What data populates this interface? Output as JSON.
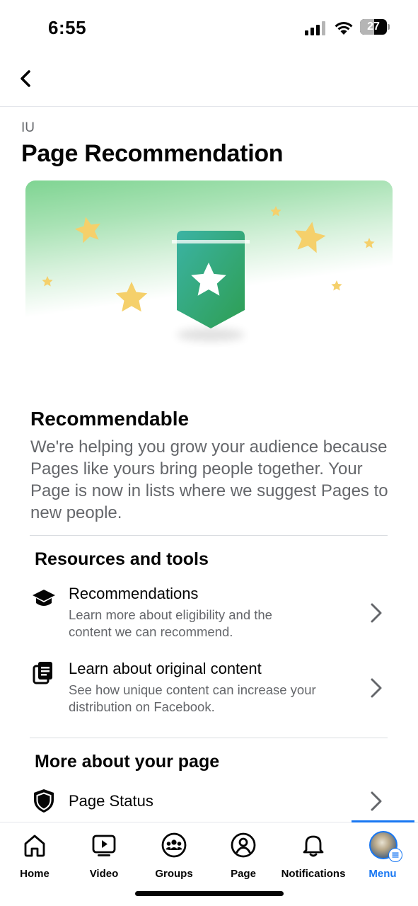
{
  "status_bar": {
    "time": "6:55",
    "battery_level": "27"
  },
  "header": {
    "back_icon": "chevron-left-icon"
  },
  "page": {
    "name": "IU",
    "title": "Page Recommendation"
  },
  "banner": {
    "icon": "ribbon-star-icon",
    "colors": {
      "ribbon": "#35a86a",
      "star": "#f5d06b",
      "gradient_top": "#7fd492"
    }
  },
  "status": {
    "title": "Recommendable",
    "description": "We're helping you grow your audience because Pages like yours bring people together. Your Page is now in lists where we suggest Pages to new people."
  },
  "resources": {
    "title": "Resources and tools",
    "items": [
      {
        "icon": "graduation-cap-icon",
        "label": "Recommendations",
        "sub_lines": [
          "Learn more about eligibility and the",
          "content we can recommend."
        ]
      },
      {
        "icon": "document-copy-icon",
        "label": "Learn about original content",
        "sub_lines": [
          "See how unique content can increase your",
          "distribution on Facebook."
        ]
      }
    ]
  },
  "more": {
    "title": "More about your page",
    "items": [
      {
        "icon": "shield-icon",
        "label": "Page Status"
      }
    ]
  },
  "tabs": [
    {
      "label": "Home",
      "icon": "home-icon"
    },
    {
      "label": "Video",
      "icon": "video-icon"
    },
    {
      "label": "Groups",
      "icon": "groups-icon"
    },
    {
      "label": "Page",
      "icon": "page-profile-icon"
    },
    {
      "label": "Notifications",
      "icon": "bell-icon"
    },
    {
      "label": "Menu",
      "icon": "avatar-menu-icon",
      "active": true
    }
  ],
  "colors": {
    "accent": "#1877f2",
    "secondary_text": "#65676b",
    "primary_text": "#050505"
  }
}
